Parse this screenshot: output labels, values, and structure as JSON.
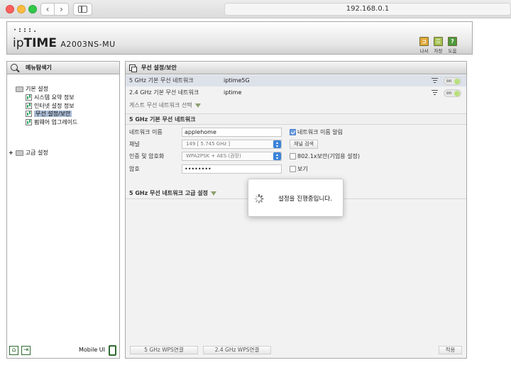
{
  "browser": {
    "url": "192.168.0.1",
    "back_label": "‹",
    "forward_label": "›"
  },
  "header": {
    "logo_dots": "·:::.",
    "brand_prefix": "ip",
    "brand_main": "TIME",
    "model": "A2003NS-MU",
    "buttons": [
      {
        "label": "나서",
        "glyph": "⊐",
        "color": "#e0a838"
      },
      {
        "label": "자장",
        "glyph": "☰",
        "color": "#a3c14c"
      },
      {
        "label": "도움",
        "glyph": "?",
        "color": "#4e9a3c"
      }
    ]
  },
  "menu": {
    "title": "메뉴탐색기",
    "basic": {
      "label": "기본 설정",
      "items": [
        "시스템 요약 정보",
        "인터넷 설정 정보",
        "무선 설정/보안",
        "펌웨어 업그레이드"
      ]
    },
    "advanced": {
      "label": "고급 설정",
      "expander": "+"
    },
    "footer": {
      "mobile_label": "Mobile UI",
      "home_glyph": "⌂",
      "exit_glyph": "⇥"
    }
  },
  "main": {
    "title": "무선 설정/보안",
    "networks": [
      {
        "label": "5 GHz 기본 무선 네트워크",
        "ssid": "iptime5G",
        "toggle": "on"
      },
      {
        "label": "2.4 GHz 기본 무선 네트워크",
        "ssid": "iptime",
        "toggle": "on"
      }
    ],
    "guest_label": "게스트 무선 네트워크 선택",
    "section_5g": "5 GHz 기본 무선 네트워크",
    "form": {
      "network_name_label": "네트워크 이름",
      "network_name_value": "applehome",
      "broadcast_label": "네트워크 이름 알림",
      "channel_label": "채널",
      "channel_value": "149 [ 5.745 GHz ]",
      "channel_search_label": "채널 검색",
      "auth_label": "인증 및 암호화",
      "auth_value": "WPA2PSK + AES (권장)",
      "dot1x_label": "802.1x보안(기업용 설정)",
      "password_label": "암호",
      "password_value": "••••••••",
      "show_label": "보기"
    },
    "advanced_title": "5 GHz 무선 네트워크 고급 설정",
    "bottom_buttons": {
      "wps5": "5 GHz WPS연결",
      "wps24": "2.4 GHz WPS연결",
      "apply": "적용"
    }
  },
  "modal": {
    "message": "설정을 진행중입니다."
  }
}
